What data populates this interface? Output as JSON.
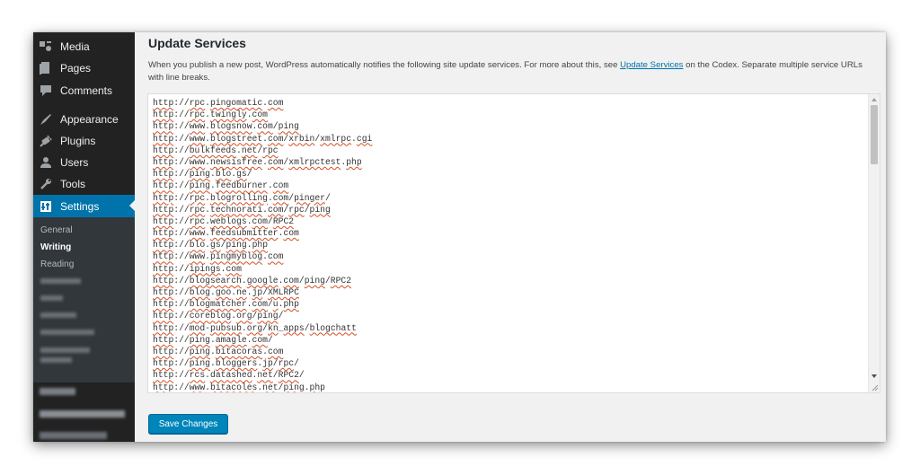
{
  "sidebar": {
    "items": [
      {
        "label": "Media",
        "icon": "media-icon"
      },
      {
        "label": "Pages",
        "icon": "pages-icon"
      },
      {
        "label": "Comments",
        "icon": "comments-icon"
      },
      {
        "label": "Appearance",
        "icon": "appearance-icon"
      },
      {
        "label": "Plugins",
        "icon": "plugins-icon"
      },
      {
        "label": "Users",
        "icon": "users-icon"
      },
      {
        "label": "Tools",
        "icon": "tools-icon"
      },
      {
        "label": "Settings",
        "icon": "settings-icon"
      }
    ],
    "submenu": [
      "General",
      "Writing",
      "Reading"
    ],
    "submenu_current": "Writing"
  },
  "main": {
    "title": "Update Services",
    "description_before": "When you publish a new post, WordPress automatically notifies the following site update services. For more about this, see ",
    "description_link": "Update Services",
    "description_after": " on the Codex. Separate multiple service URLs with line breaks.",
    "services": [
      "http://rpc.pingomatic.com",
      "http://rpc.twingly.com",
      "http://www.blogsnow.com/ping",
      "http://www.blogstreet.com/xrbin/xmlrpc.cgi",
      "http://bulkfeeds.net/rpc",
      "http://www.newsisfree.com/xmlrpctest.php",
      "http://ping.blo.gs/",
      "http://ping.feedburner.com",
      "http://rpc.blogrolling.com/pinger/",
      "http://rpc.technorati.com/rpc/ping",
      "http://rpc.weblogs.com/RPC2",
      "http://www.feedsubmitter.com",
      "http://blo.gs/ping.php",
      "http://www.pingmyblog.com",
      "http://ipings.com",
      "http://blogsearch.google.com/ping/RPC2",
      "http://blog.goo.ne.jp/XMLRPC",
      "http://blogmatcher.com/u.php",
      "http://coreblog.org/ping/",
      "http://mod-pubsub.org/kn_apps/blogchatt",
      "http://ping.amagle.com/",
      "http://ping.bitacoras.com",
      "http://ping.bloggers.jp/rpc/",
      "http://rcs.datashed.net/RPC2/",
      "http://www.bitacoles.net/ping.php"
    ],
    "save_label": "Save Changes"
  },
  "colors": {
    "sidebar_bg": "#222222",
    "submenu_bg": "#32373c",
    "accent": "#0073aa",
    "button": "#0085ba",
    "spell_underline": "#d54e21"
  }
}
